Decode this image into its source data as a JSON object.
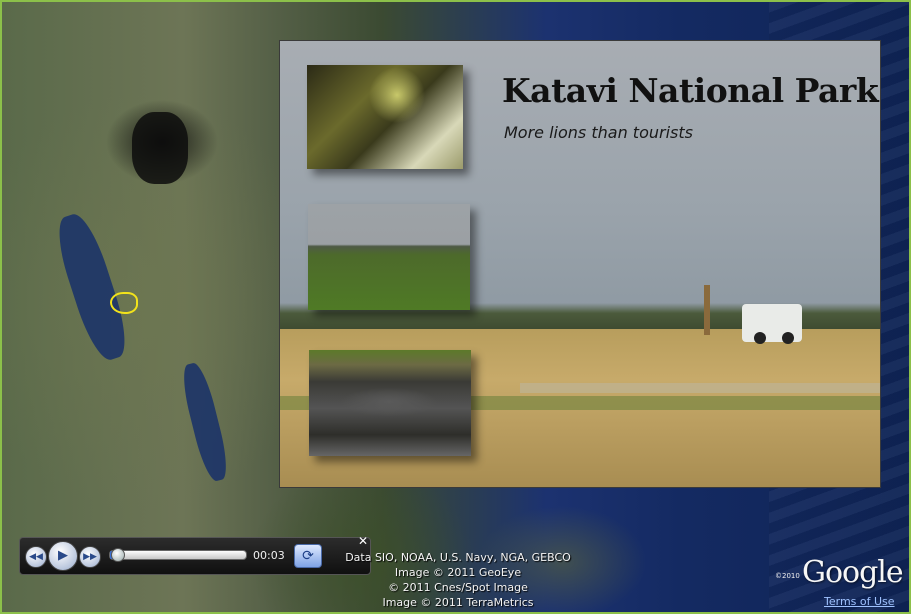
{
  "slide": {
    "title": "Katavi National Park",
    "subtitle": "More lions than tourists"
  },
  "tour_player": {
    "rewind_icon": "rewind-icon",
    "play_icon": "play-icon",
    "fast_forward_icon": "fast-forward-icon",
    "loop_icon": "loop-icon",
    "close_icon": "close-icon",
    "elapsed_time": "00:03",
    "progress_fraction": 0.02
  },
  "attribution": {
    "lines": [
      "Data SIO, NOAA, U.S. Navy, NGA, GEBCO",
      "Image © 2011 GeoEye",
      "© 2011 Cnes/Spot Image",
      "Image © 2011 TerraMetrics"
    ]
  },
  "branding": {
    "logo": "Google",
    "copyright_year": "©2010",
    "terms_link": "Terms of Use"
  },
  "colors": {
    "frame_border": "#8cc04a",
    "park_outline": "#f2e21b",
    "link": "#9fc2ff"
  }
}
